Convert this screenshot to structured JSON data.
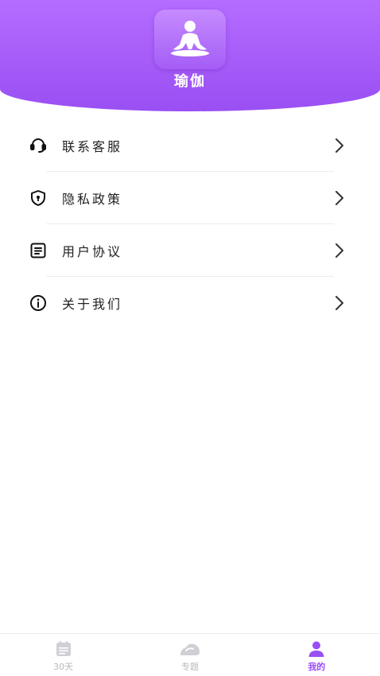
{
  "header": {
    "app_icon": "yoga-meditation-icon",
    "title": "瑜伽",
    "gradient_top": "#b46cff",
    "gradient_bottom": "#9a4ff3"
  },
  "menu": {
    "items": [
      {
        "label": "联系客服",
        "icon": "headset-icon"
      },
      {
        "label": "隐私政策",
        "icon": "shield-lock-icon"
      },
      {
        "label": "用户协议",
        "icon": "document-icon"
      },
      {
        "label": "关于我们",
        "icon": "info-icon"
      }
    ]
  },
  "bottom_nav": {
    "tabs": [
      {
        "label": "30天",
        "icon": "calendar-icon",
        "active": false
      },
      {
        "label": "专题",
        "icon": "topic-icon",
        "active": false
      },
      {
        "label": "我的",
        "icon": "user-icon",
        "active": true
      }
    ],
    "active_color": "#9a4ff3",
    "inactive_color": "#c8c8c8"
  }
}
